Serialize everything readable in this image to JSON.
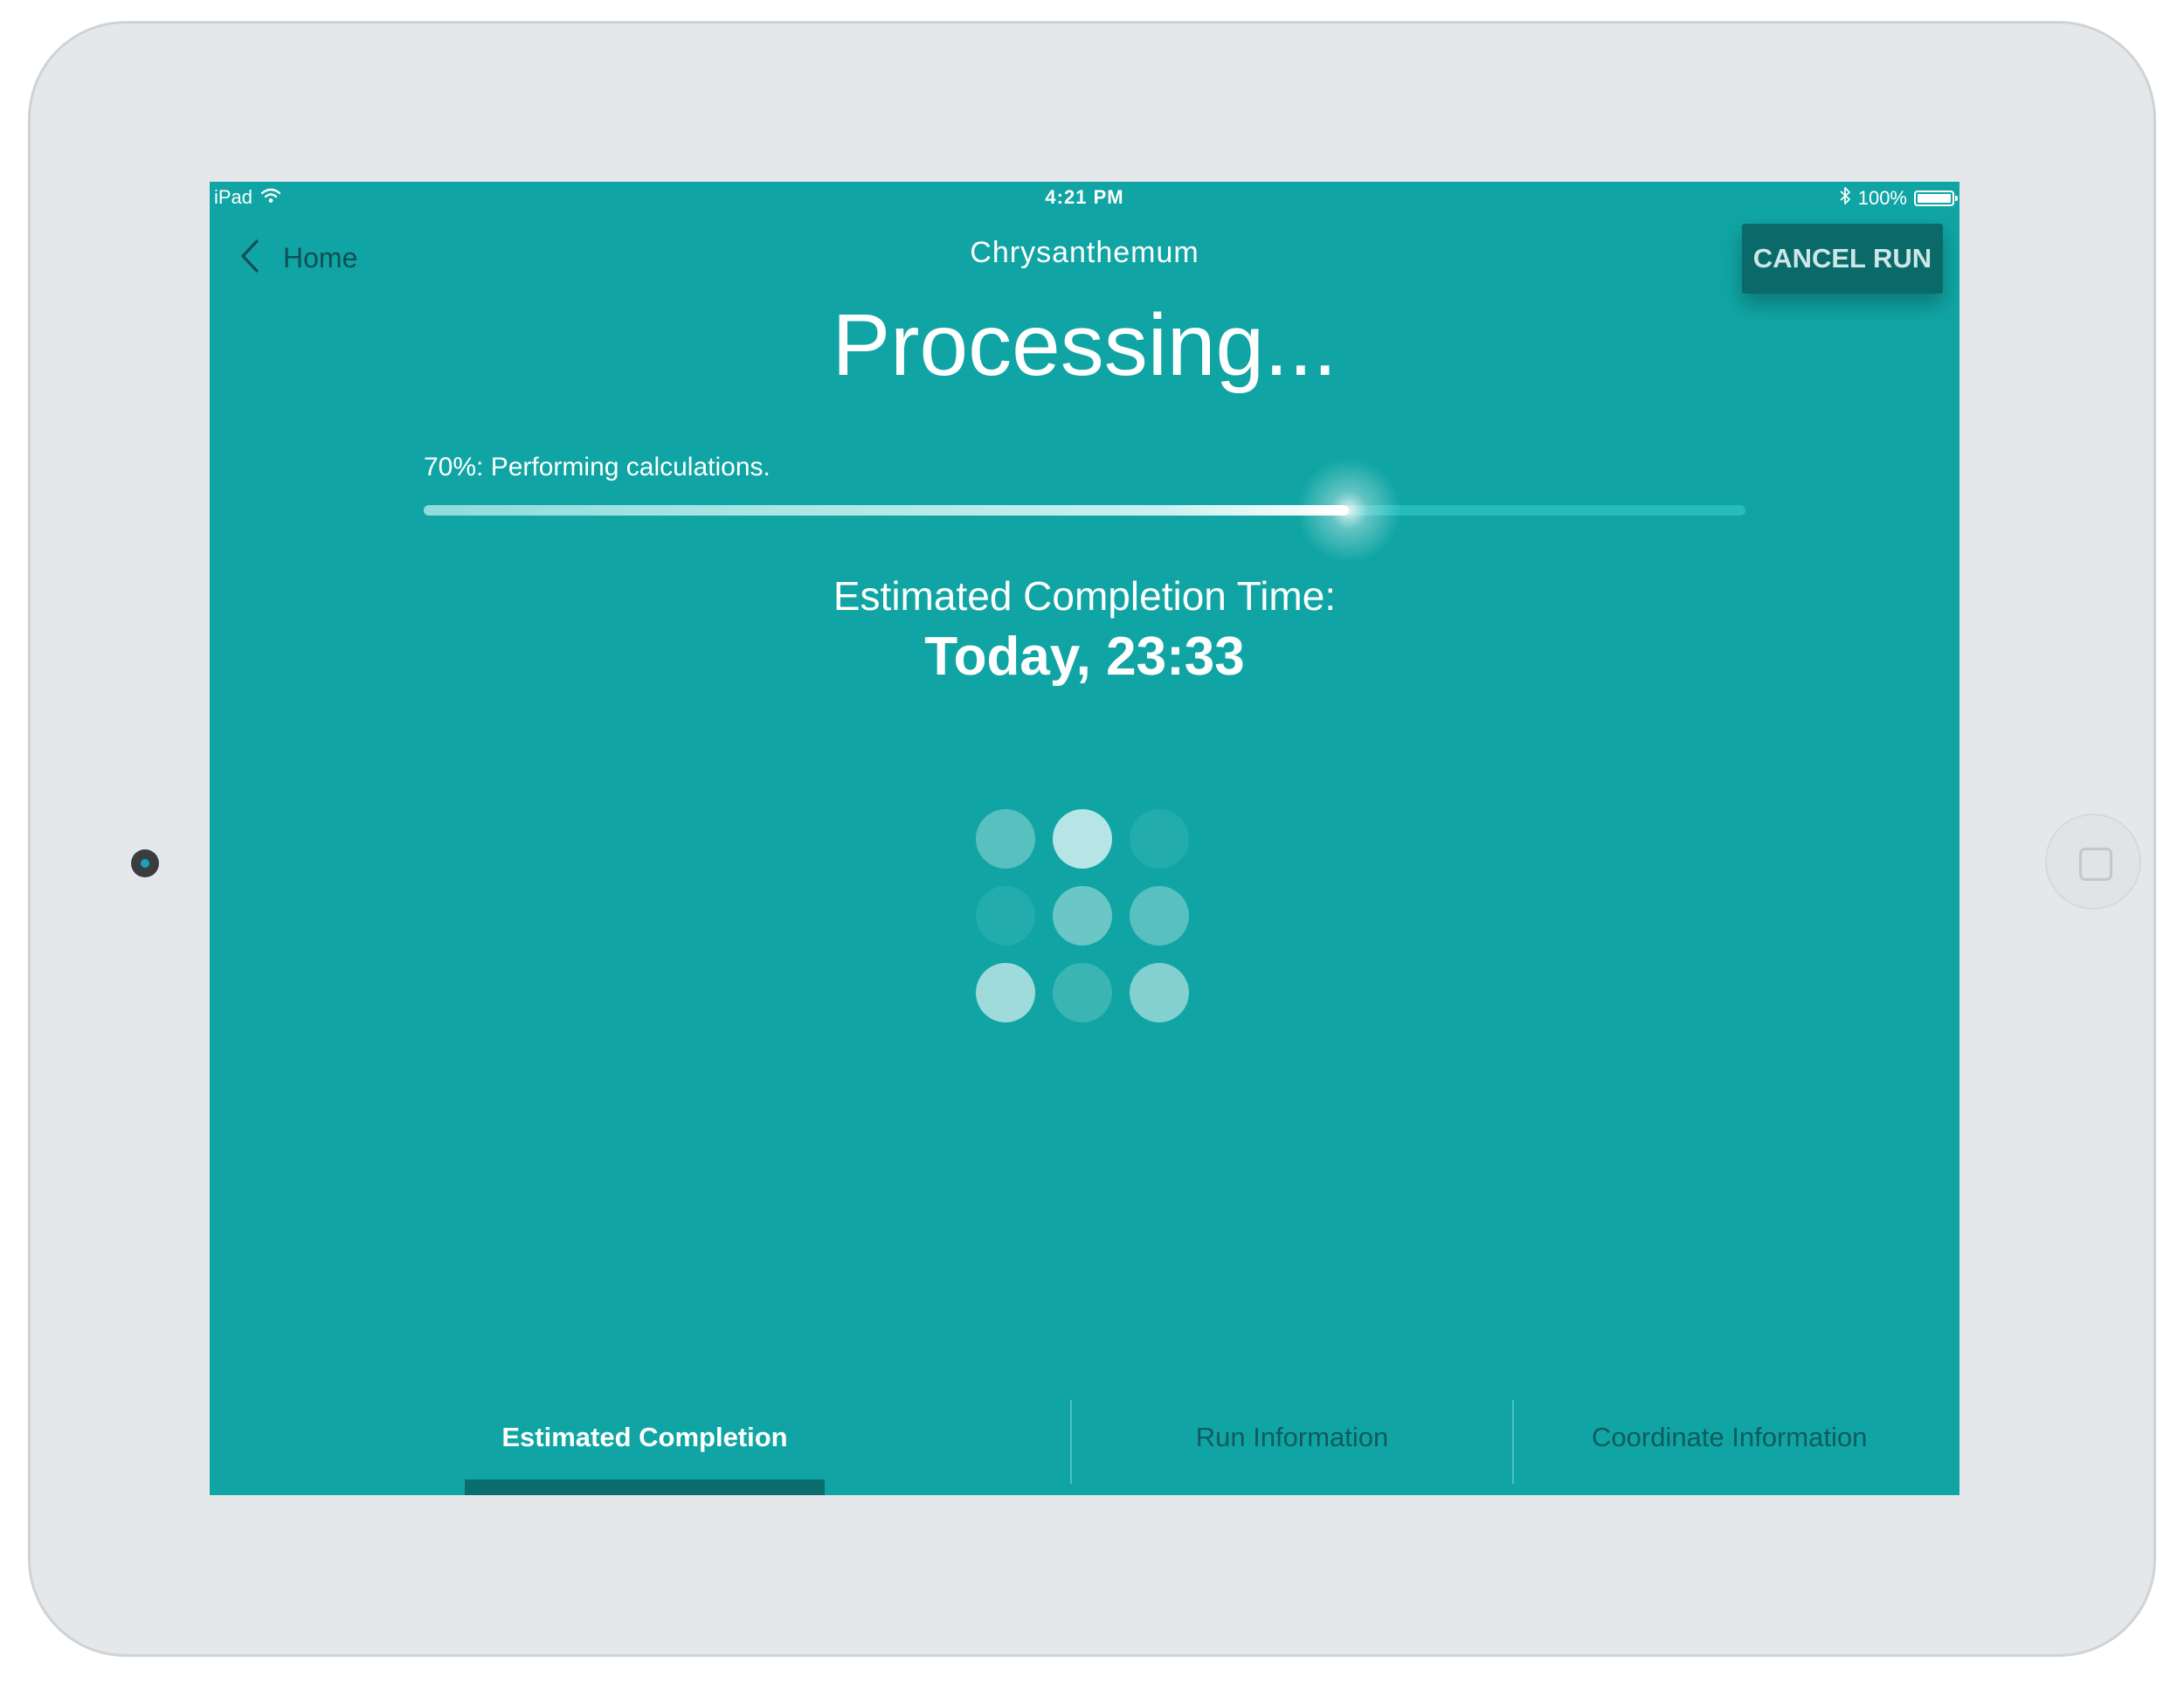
{
  "status_bar": {
    "device": "iPad",
    "time": "4:21 PM",
    "battery": "100%"
  },
  "nav": {
    "back_label": "Home",
    "title": "Chrysanthemum",
    "cancel_label": "CANCEL RUN"
  },
  "main": {
    "heading": "Processing...",
    "progress_text": "70%: Performing calculations.",
    "progress_fraction": 0.7,
    "completion_label": "Estimated Completion Time:",
    "completion_value": "Today, 23:33"
  },
  "loader": {
    "dot_opacities": [
      0.3,
      0.7,
      0.08,
      0.08,
      0.38,
      0.3,
      0.6,
      0.18,
      0.48
    ]
  },
  "tabs": [
    {
      "label": "Estimated Completion",
      "active": true
    },
    {
      "label": "Run Information",
      "active": false
    },
    {
      "label": "Coordinate Information",
      "active": false
    }
  ],
  "colors": {
    "screen_bg": "#10a5a4",
    "accent_dark": "#0a6a6a",
    "device_frame": "#e4e8eb"
  }
}
